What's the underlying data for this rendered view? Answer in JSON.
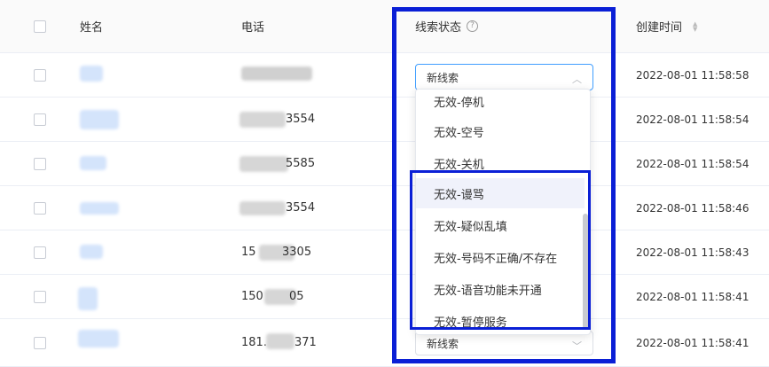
{
  "header": {
    "name": "姓名",
    "phone": "电话",
    "status": "线索状态",
    "status_help_icon": "?",
    "created": "创建时间"
  },
  "rows": [
    {
      "phone_partial": "",
      "time": "2022-08-01 11:58:58"
    },
    {
      "phone_partial": "3554",
      "time": "2022-08-01 11:58:54"
    },
    {
      "phone_partial": "5585",
      "time": "2022-08-01 11:58:54"
    },
    {
      "phone_partial": "3554",
      "time": "2022-08-01 11:58:46"
    },
    {
      "phone_prefix": "15",
      "phone_partial": "3305",
      "time": "2022-08-01 11:58:43"
    },
    {
      "phone_prefix": "150",
      "phone_partial": "05",
      "time": "2022-08-01 11:58:41"
    },
    {
      "phone_prefix": "181.",
      "phone_partial": "371",
      "time": "2022-08-01 11:58:41"
    }
  ],
  "status_select": {
    "value": "新线索",
    "value_bottom": "新线索"
  },
  "dropdown": {
    "options": [
      "无效-停机",
      "无效-空号",
      "无效-关机",
      "无效-谩骂",
      "无效-疑似乱填",
      "无效-号码不正确/不存在",
      "无效-语音功能未开通",
      "无效-暂停服务"
    ],
    "hovered": "无效-谩骂"
  },
  "colors": {
    "highlight_frame": "#0a1fd6",
    "select_border": "#409eff",
    "hover_bg": "#f0f2fb"
  }
}
